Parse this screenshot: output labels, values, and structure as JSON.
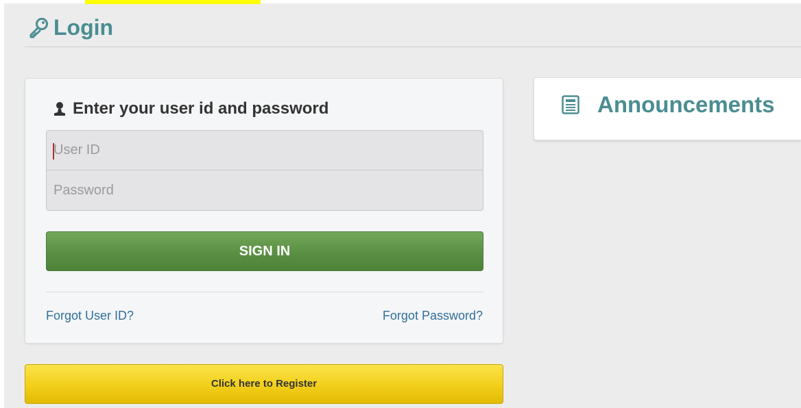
{
  "header": {
    "title": "Login",
    "icon": "key-icon",
    "title_color": "#4a8d91"
  },
  "login": {
    "heading": "Enter your user id and password",
    "heading_icon": "user-icon",
    "user_id_placeholder": "User ID",
    "password_placeholder": "Password",
    "signin_label": "SIGN IN",
    "forgot_user_id": "Forgot User ID?",
    "forgot_password": "Forgot Password?",
    "signin_color": "#5a8f44",
    "link_color": "#2f6f9a"
  },
  "register": {
    "label": "Click here to Register",
    "color": "#f2cf1a"
  },
  "announcements": {
    "title": "Announcements",
    "icon": "newspaper-icon"
  }
}
